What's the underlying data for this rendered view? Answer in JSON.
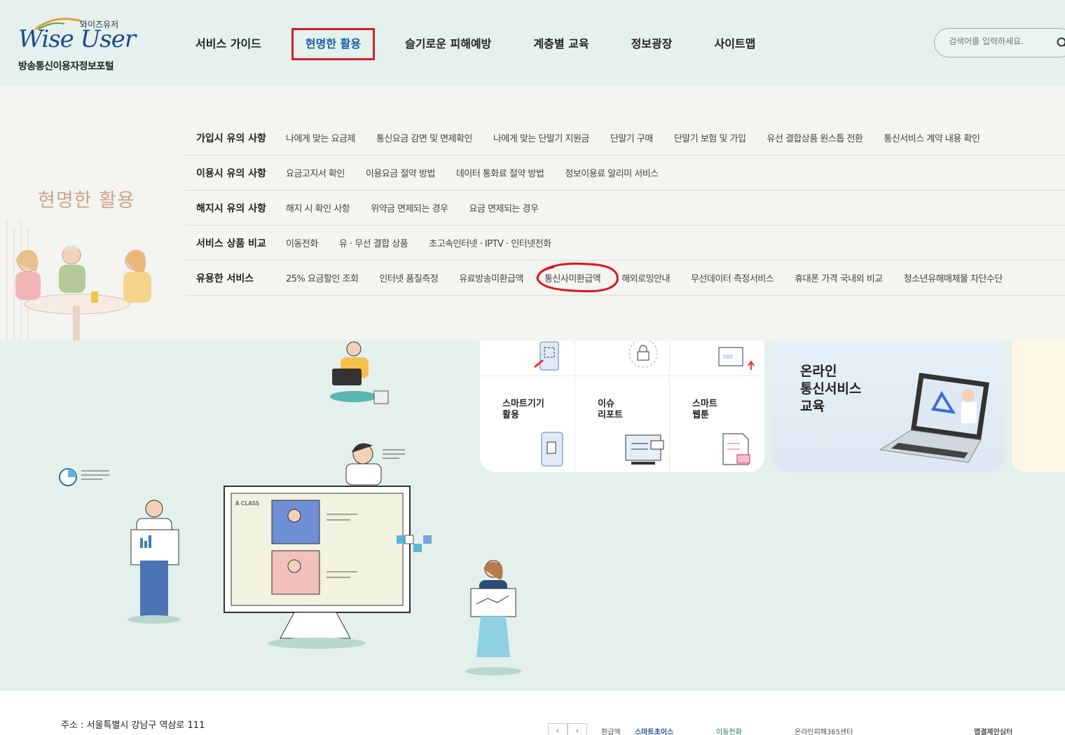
{
  "header": {
    "logo_small": "와이즈유저",
    "logo_main": "Wise User",
    "logo_sub": "방송통신이용자정보포털",
    "nav": [
      "서비스 가이드",
      "현명한 활용",
      "슬기로운 피해예방",
      "계층별 교육",
      "정보광장",
      "사이트맵"
    ],
    "search_placeholder": "검색어를 입력하세요."
  },
  "mega": {
    "title": "현명한 활용",
    "rows": [
      {
        "cat": "가입시 유의 사항",
        "links": [
          "나에게 맞는 요금제",
          "통신요금 감면 및 면제확인",
          "나에게 맞는 단말기 지원금",
          "단말기 구매",
          "단말기 보험 및 가입",
          "유선 결합상품 원스톱 전환",
          "통신서비스 계약 내용 확인"
        ]
      },
      {
        "cat": "이용시 유의 사항",
        "links": [
          "요금고지서 확인",
          "이용요금 절약 방법",
          "데이터 통화료 절약 방법",
          "정보이용료 알리미 서비스"
        ]
      },
      {
        "cat": "해지시 유의 사항",
        "links": [
          "해지 시 확인 사항",
          "위약금 면제되는 경우",
          "요금 면제되는 경우"
        ]
      },
      {
        "cat": "서비스 상품 비교",
        "links": [
          "이동전화",
          "유 · 무선 결합 상품",
          "초고속인터넷 · IPTV · 인터넷전화"
        ]
      },
      {
        "cat": "유용한 서비스",
        "links": [
          "25% 요금할인 조회",
          "인터넷 품질측정",
          "유료방송미환급액",
          "통신사미환급액",
          "해외로밍안내",
          "무선데이터 측정서비스",
          "휴대폰 가격 국내외 비교",
          "청소년유해매체물 차단수단"
        ]
      }
    ]
  },
  "cards": [
    {
      "label": "스마트기기\n활용"
    },
    {
      "label": "이슈\n리포트"
    },
    {
      "label": "스마트\n웹툰"
    }
  ],
  "online": {
    "label": "온라인\n통신서비스\n교육"
  },
  "footer": {
    "address": "주소 : 서울특별시 강남구 역삼로 111",
    "prev": "‹",
    "next": "›",
    "banners": [
      "환급액",
      "스마트초이스",
      "이동전화",
      "온라인피해365센터",
      "",
      "앱결제안심터"
    ]
  },
  "colors": {
    "active_border": "#d0202e",
    "active_text": "#1e5aa8",
    "mega_title": "#c9a68a",
    "bg_mint": "#e3f0ec"
  }
}
